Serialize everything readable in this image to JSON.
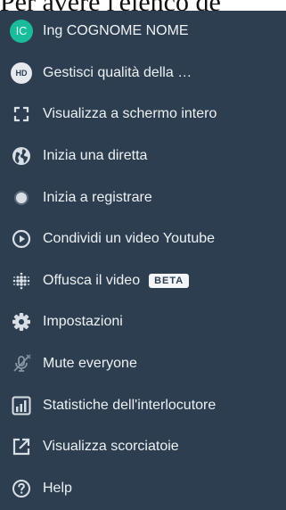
{
  "background_text": "Per avere l'elenco de",
  "menu": {
    "items": [
      {
        "id": "profile",
        "label": "Ing COGNOME NOME",
        "icon": "avatar-initials",
        "avatar": {
          "initials": "IC",
          "color": "#1abc9c"
        }
      },
      {
        "id": "quality",
        "label": "Gestisci qualità della …",
        "icon": "hd-icon",
        "badge": "HD"
      },
      {
        "id": "fullscreen",
        "label": "Visualizza a schermo intero",
        "icon": "fullscreen-icon"
      },
      {
        "id": "livestream",
        "label": "Inizia una diretta",
        "icon": "globe-icon"
      },
      {
        "id": "record",
        "label": "Inizia a registrare",
        "icon": "record-icon"
      },
      {
        "id": "youtube",
        "label": "Condividi un video Youtube",
        "icon": "play-circle-icon"
      },
      {
        "id": "blur",
        "label": "Offusca il video",
        "icon": "blur-icon",
        "tag": "BETA"
      },
      {
        "id": "settings",
        "label": "Impostazioni",
        "icon": "gear-icon"
      },
      {
        "id": "mute",
        "label": "Mute everyone",
        "icon": "mic-off-icon"
      },
      {
        "id": "stats",
        "label": "Statistiche dell'interlocutore",
        "icon": "bar-chart-icon"
      },
      {
        "id": "shortcuts",
        "label": "Visualizza scorciatoie",
        "icon": "open-external-icon"
      },
      {
        "id": "help",
        "label": "Help",
        "icon": "help-icon"
      }
    ]
  },
  "colors": {
    "menu_bg": "#2c3e50",
    "text": "#eef1f4",
    "icon": "#d8dee5",
    "avatar_bg": "#1abc9c"
  }
}
